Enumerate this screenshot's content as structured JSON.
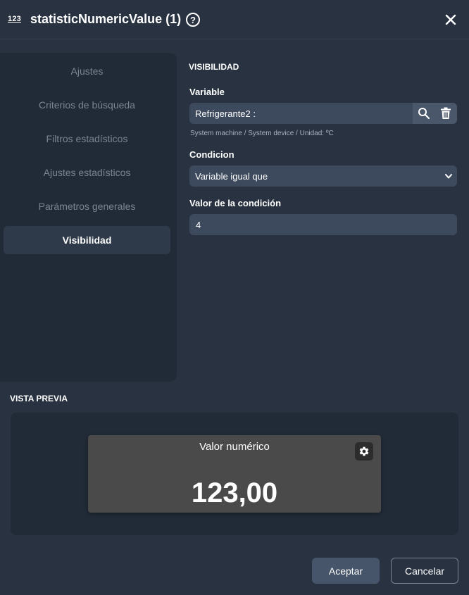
{
  "header": {
    "icon_text": "123",
    "title": "statisticNumericValue (1)",
    "help_glyph": "?"
  },
  "sidebar": {
    "items": [
      {
        "label": "Ajustes",
        "active": false
      },
      {
        "label": "Criterios de búsqueda",
        "active": false
      },
      {
        "label": "Filtros estadísticos",
        "active": false
      },
      {
        "label": "Ajustes estadísticos",
        "active": false
      },
      {
        "label": "Parámetros generales",
        "active": false
      },
      {
        "label": "Visibilidad",
        "active": true
      }
    ]
  },
  "form": {
    "section_title": "VISIBILIDAD",
    "variable_label": "Variable",
    "variable_value": "Refrigerante2 :",
    "variable_hint": "System machine / System device / Unidad: ºC",
    "condition_label": "Condicion",
    "condition_value": "Variable igual que",
    "condition_value_label": "Valor de la condición",
    "condition_value_value": "4"
  },
  "preview": {
    "section_title": "VISTA PREVIA",
    "widget_title": "Valor numérico",
    "widget_value": "123,00"
  },
  "footer": {
    "accept_label": "Aceptar",
    "cancel_label": "Cancelar"
  },
  "colors": {
    "background": "#283241",
    "sidebar": "#212b37",
    "input": "#3d4a5d",
    "widget": "#4a4a4a",
    "accept_button": "#46556a"
  }
}
